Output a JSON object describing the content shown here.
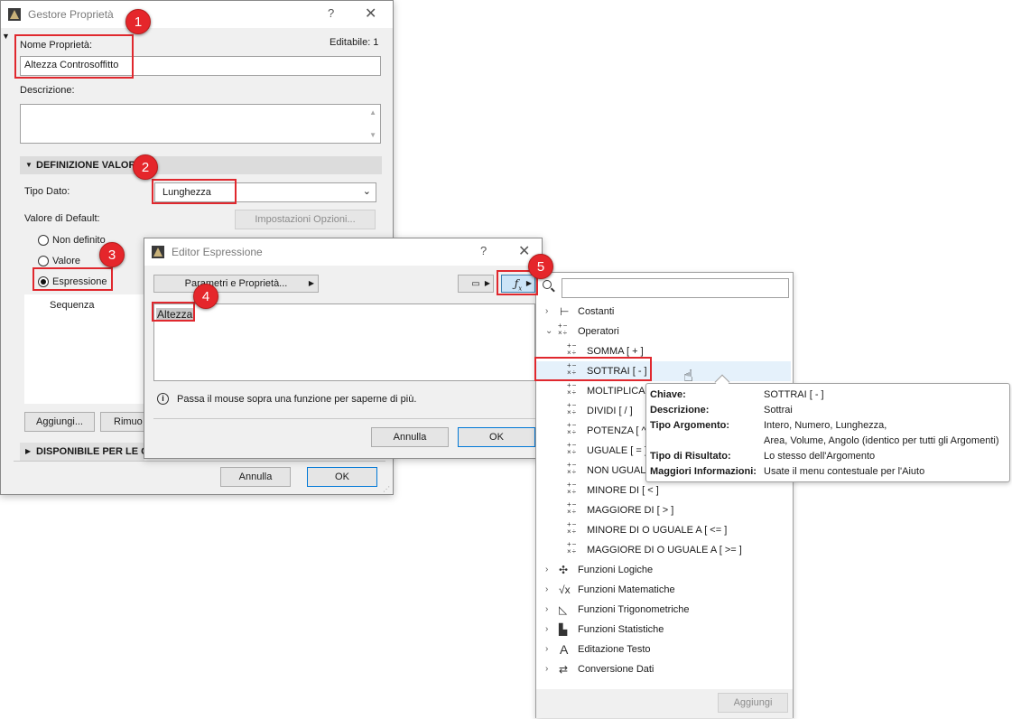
{
  "gestore": {
    "title": "Gestore Proprietà",
    "help": "?",
    "close": "✕",
    "name_label": "Nome Proprietà:",
    "editable": "Editabile: 1",
    "name_value": "Altezza Controsoffitto",
    "desc_label": "Descrizione:",
    "section_value_def": "DEFINIZIONE VALORE",
    "tipo_dato_label": "Tipo Dato:",
    "tipo_dato_value": "Lunghezza",
    "default_label": "Valore di Default:",
    "options_button": "Impostazioni Opzioni...",
    "radio_undefined": "Non definito",
    "radio_value": "Valore",
    "radio_expression": "Espressione",
    "list_item": "Sequenza",
    "add_button": "Aggiungi...",
    "remove_button": "Rimuo",
    "section_available": "DISPONIBILE PER LE CL",
    "cancel": "Annulla",
    "ok": "OK"
  },
  "editor": {
    "title": "Editor Espressione",
    "help": "?",
    "close": "✕",
    "params_button": "Parametri e Proprietà...",
    "expression": "Altezza",
    "info_text": "Passa il mouse sopra una funzione per saperne di più.",
    "cancel": "Annulla",
    "ok": "OK"
  },
  "functions_panel": {
    "search_placeholder": "",
    "items": [
      {
        "label": "Costanti",
        "icon": "constants-icon",
        "expanded": false
      },
      {
        "label": "Operatori",
        "icon": "operators-icon",
        "expanded": true
      }
    ],
    "operators": [
      "SOMMA [ + ]",
      "SOTTRAI [ - ]",
      "MOLTIPLICA [",
      "DIVIDI  [ / ]",
      "POTENZA  [ ^",
      "UGUALE [ = ]",
      "NON UGUAL",
      "MINORE DI [ < ]",
      "MAGGIORE DI [ > ]",
      "MINORE DI O UGUALE A  [ <= ]",
      "MAGGIORE DI O UGUALE A  [ >= ]"
    ],
    "groups": [
      "Funzioni Logiche",
      "Funzioni Matematiche",
      "Funzioni Trigonometriche",
      "Funzioni Statistiche",
      "Editazione Testo",
      "Conversione Dati"
    ],
    "add_button": "Aggiungi"
  },
  "tooltip": {
    "key_label": "Chiave:",
    "key_value": "SOTTRAI [ - ]",
    "desc_label": "Descrizione:",
    "desc_value": "Sottrai",
    "arg_label": "Tipo Argomento:",
    "arg_value_1": "Intero, Numero, Lunghezza,",
    "arg_value_2": "Area, Volume, Angolo (identico per tutti gli Argomenti)",
    "result_label": "Tipo di Risultato:",
    "result_value": "Lo stesso dell'Argomento",
    "more_label": "Maggiori Informazioni:",
    "more_value": "Usate il menu contestuale per l'Aiuto"
  },
  "badges": [
    "1",
    "2",
    "3",
    "4",
    "5"
  ],
  "colors": {
    "callout": "#e0282e",
    "badge": "#e5262b",
    "highlight": "#cce4f7",
    "primary_border": "#0078d7"
  }
}
